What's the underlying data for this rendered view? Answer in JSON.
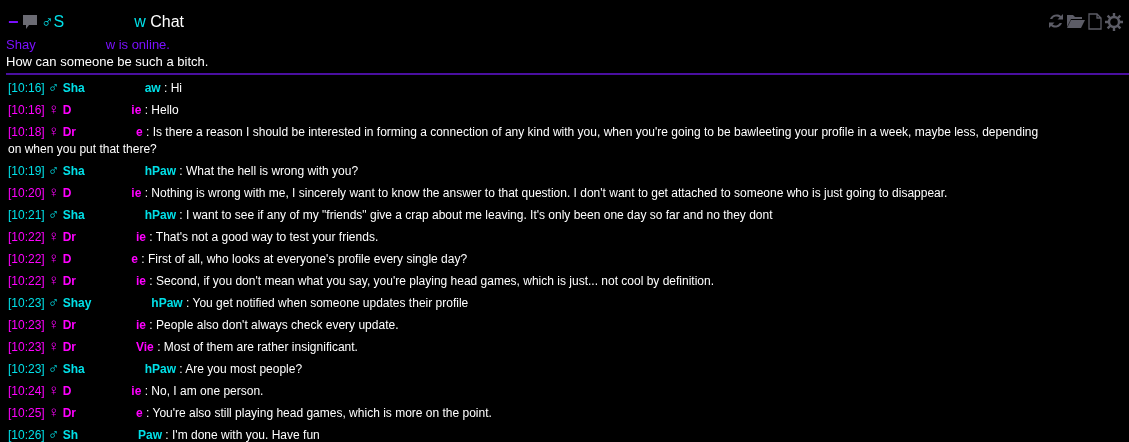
{
  "header": {
    "minimize": "−",
    "symbol": "♂",
    "name_start": "S",
    "name_end": "w",
    "title": "Chat"
  },
  "status": {
    "name_start": "Shay",
    "name_end": "w is online.",
    "message": "How can someone be such a bitch."
  },
  "messages": [
    {
      "time": "[10:16]",
      "kind": "male",
      "symbol": "♂",
      "name_start": "Sha",
      "name_end": "aw",
      "separator": ":",
      "text": "Hi"
    },
    {
      "time": "[10:16]",
      "kind": "female",
      "symbol": "♀",
      "name_start": "D",
      "name_end": "ie",
      "separator": ":",
      "text": "Hello"
    },
    {
      "time": "[10:18]",
      "kind": "female",
      "symbol": "♀",
      "name_start": "Dr",
      "name_end": "e",
      "separator": ":",
      "text": "Is there a reason I should be interested in forming a connection of any kind with you, when you're going to be bawleeting your profile in a week, maybe less, depending",
      "text_continued": "on when you put that there?"
    },
    {
      "time": "[10:19]",
      "kind": "male",
      "symbol": "♂",
      "name_start": "Sha",
      "name_end": "hPaw",
      "separator": ":",
      "text": "What the hell is wrong with you?"
    },
    {
      "time": "[10:20]",
      "kind": "female",
      "symbol": "♀",
      "name_start": "D",
      "name_end": "ie",
      "separator": ":",
      "text": "Nothing is wrong with me, I sincerely want to know the answer to that question.  I don't want to get attached to someone who is just going to disappear."
    },
    {
      "time": "[10:21]",
      "kind": "male",
      "symbol": "♂",
      "name_start": "Sha",
      "name_end": "hPaw",
      "separator": ":",
      "text": "I want to see if any of my \"friends\" give a crap about me leaving. It's only been one day so far and no they dont"
    },
    {
      "time": "[10:22]",
      "kind": "female",
      "symbol": "♀",
      "name_start": "Dr",
      "name_end": "ie",
      "separator": ":",
      "text": "That's not a good way to test your friends."
    },
    {
      "time": "[10:22]",
      "kind": "female",
      "symbol": "♀",
      "name_start": "D",
      "name_end": "e",
      "separator": ":",
      "text": "First of all, who looks at everyone's profile every single day?"
    },
    {
      "time": "[10:22]",
      "kind": "female",
      "symbol": "♀",
      "name_start": "Dr",
      "name_end": "ie",
      "separator": ":",
      "text": "Second, if you don't mean what you say, you're playing head games, which is just... not cool by definition."
    },
    {
      "time": "[10:23]",
      "kind": "male",
      "symbol": "♂",
      "name_start": "Shay",
      "name_end": "hPaw",
      "separator": ":",
      "text": "You get notified when someone updates their profile"
    },
    {
      "time": "[10:23]",
      "kind": "female",
      "symbol": "♀",
      "name_start": "Dr",
      "name_end": "ie",
      "separator": ":",
      "text": "People also don't always check every update."
    },
    {
      "time": "[10:23]",
      "kind": "female",
      "symbol": "♀",
      "name_start": "Dr",
      "name_end": "Vie",
      "separator": ":",
      "text": "Most of them are rather insignificant."
    },
    {
      "time": "[10:23]",
      "kind": "male",
      "symbol": "♂",
      "name_start": "Sha",
      "name_end": "hPaw",
      "separator": ":",
      "text": "Are you most people?"
    },
    {
      "time": "[10:24]",
      "kind": "female",
      "symbol": "♀",
      "name_start": "D",
      "name_end": "ie",
      "separator": ":",
      "text": "No, I am one person."
    },
    {
      "time": "[10:25]",
      "kind": "female",
      "symbol": "♀",
      "name_start": "Dr",
      "name_end": "e",
      "separator": ":",
      "text": "You're also still playing head games, which is more on the point."
    },
    {
      "time": "[10:26]",
      "kind": "male",
      "symbol": "♂",
      "name_start": "Sh",
      "name_end": "Paw",
      "separator": ":",
      "text": "I'm done with you. Have fun"
    }
  ]
}
